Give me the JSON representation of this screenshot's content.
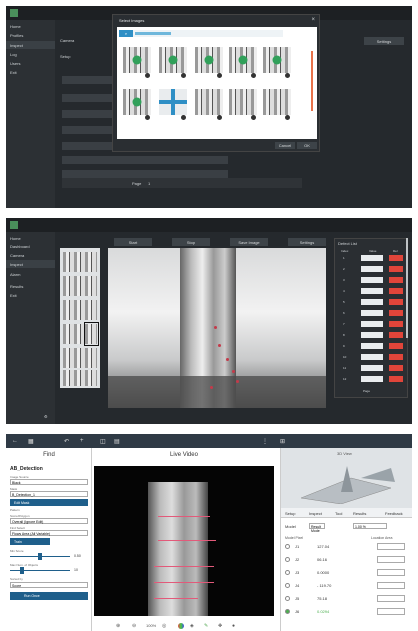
{
  "panel1": {
    "sidebar": [
      "Home",
      "Profiles",
      "Inspect",
      "Log",
      "Users",
      "Exit"
    ],
    "header_label": "Camera",
    "setup_label": "Setup",
    "right_button": "Settings",
    "dialog": {
      "title": "Select Images",
      "close": "×",
      "search_placeholder": "Search",
      "thumb_badges": [
        "1",
        "2",
        "3",
        "4",
        "5",
        "6",
        "7",
        "8",
        "9",
        "10"
      ],
      "cancel": "Cancel",
      "ok": "OK"
    },
    "pager": {
      "page": "Page",
      "num": "1"
    }
  },
  "panel2": {
    "sidebar": [
      "Home",
      "Dashboard",
      "Camera",
      "Inspect",
      "Alarm",
      "Results",
      "Exit"
    ],
    "toolbar": [
      "Start",
      "Stop",
      "Save Image",
      "Settings"
    ],
    "table_title": "Defect List",
    "table_headers": [
      "Index",
      "Value",
      "Del"
    ],
    "rows": [
      "1",
      "2",
      "3",
      "4",
      "5",
      "6",
      "7",
      "8",
      "9",
      "10",
      "11",
      "12"
    ],
    "pager": "Page"
  },
  "panel3": {
    "find_title": "Find",
    "live_title": "Live Video",
    "roi_title": "3D View",
    "find": {
      "section": "AB_Detection",
      "labels": [
        "Image Source",
        "Mask",
        "Pattern",
        "Score/Polygon",
        "Find Select",
        "Min Score",
        "Max Num. of Objects",
        "Sorted by"
      ],
      "values": [
        "Black",
        "B_Detection_1",
        "Overall (Ignore Edit)",
        "Flows Area (All Variable)",
        "Score"
      ],
      "buttons": [
        "Edit Mask",
        "Train",
        "Run Once"
      ],
      "slider_value": "0.50",
      "objects_value": "10"
    },
    "tabs": [
      "Setup",
      "Inspect",
      "Tool",
      "Results",
      "Feedback"
    ],
    "result_header": [
      "Model",
      "Result Mode",
      "1.00 %"
    ],
    "col_headers": [
      "Model Pixel",
      "Location Area"
    ],
    "results": [
      {
        "id": "J1",
        "value": "127.04"
      },
      {
        "id": "J2",
        "value": "06.16"
      },
      {
        "id": "J3",
        "value": "0.0000"
      },
      {
        "id": "J4",
        "value": "- 119.70"
      },
      {
        "id": "J5",
        "value": "75.18"
      },
      {
        "id": "J6",
        "value": "0.0294"
      }
    ],
    "bottom_icons": [
      "zoom-in",
      "zoom-out",
      "fit",
      "color",
      "3d",
      "draw",
      "pan",
      "reset",
      "record"
    ],
    "zoom": "100%"
  }
}
